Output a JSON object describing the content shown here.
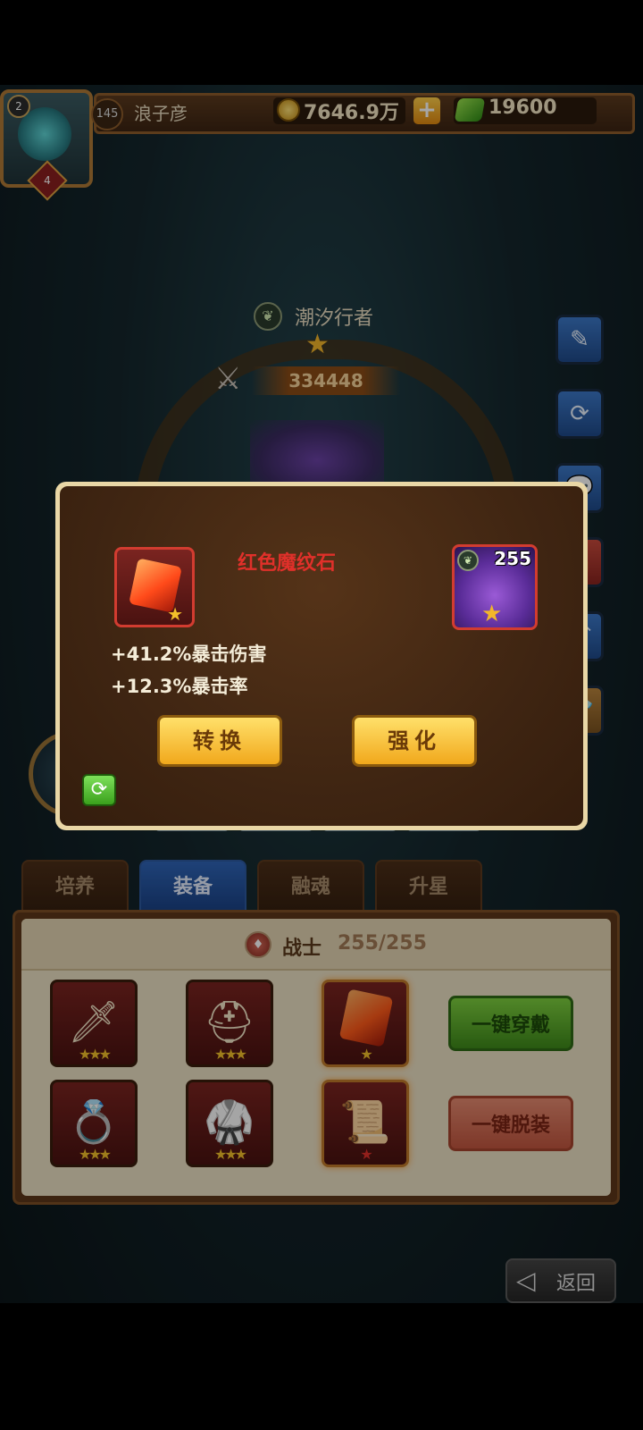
{
  "topbar": {
    "player_level": "145",
    "player_name": "浪子彦",
    "avatar_level": "2",
    "avatar_rank": "4",
    "gold": "7646.9万",
    "plus": "+",
    "gems": "19600"
  },
  "hero": {
    "name": "潮汐行者",
    "power": "334448"
  },
  "tabs": [
    "培养",
    "装备",
    "融魂",
    "升星"
  ],
  "equipment_panel": {
    "class_name": "战士",
    "progress": "255/255",
    "wear_all_label": "一键穿戴",
    "remove_all_label": "一键脱装",
    "items": [
      {
        "icon": "sword-icon",
        "glyph": "🗡",
        "stars": "★★★"
      },
      {
        "icon": "helmet-icon",
        "glyph": "⛑",
        "stars": "★★★"
      },
      {
        "icon": "red-rune-stone-icon",
        "glyph": "",
        "stars": "★"
      },
      {
        "icon": "ring-icon",
        "glyph": "💍",
        "stars": "★★★"
      },
      {
        "icon": "armor-icon",
        "glyph": "🥋",
        "stars": "★★★"
      },
      {
        "icon": "scroll-icon",
        "glyph": "📜",
        "stars": "★"
      }
    ]
  },
  "return_label": "返回",
  "dialog": {
    "item_name": "红色魔纹石",
    "hero_level": "255",
    "stats": [
      "+41.2%暴击伤害",
      "+12.3%暴击率"
    ],
    "convert_label": "转换",
    "enhance_label": "强化"
  },
  "colors": {
    "accent_gold": "#f1a81c",
    "item_name_red": "#e0302a",
    "tab_active_blue": "#2f65b8",
    "button_green": "#7ed03f"
  }
}
